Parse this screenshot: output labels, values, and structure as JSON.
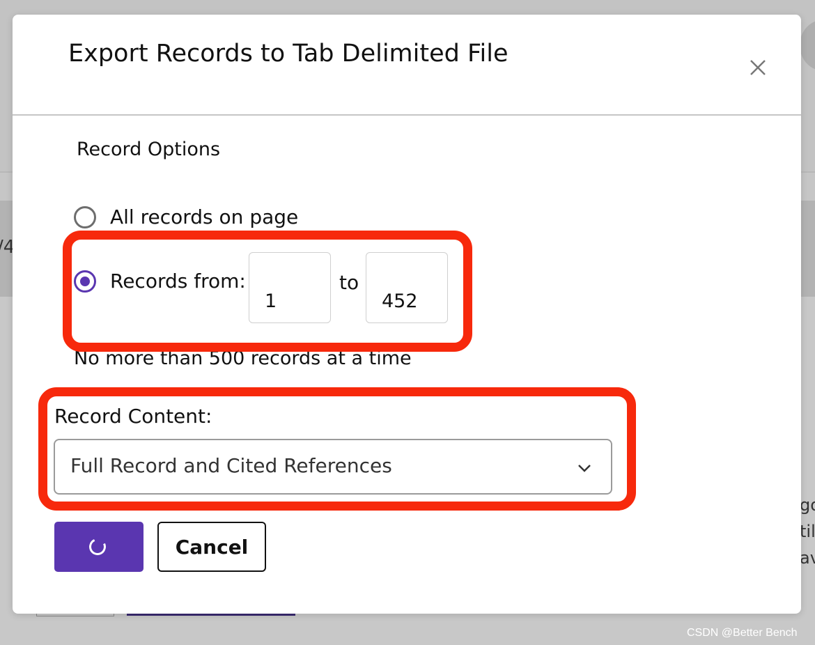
{
  "dialog": {
    "title": "Export Records to Tab Delimited File",
    "close_icon": "close-icon"
  },
  "record_options": {
    "label": "Record Options",
    "options": [
      {
        "label": "All records on page",
        "selected": false
      },
      {
        "label": "Records from:",
        "selected": true
      }
    ],
    "from_value": "1",
    "to_label": "to",
    "to_value": "452",
    "limit_note": "No more than 500 records at a time"
  },
  "record_content": {
    "label": "Record Content:",
    "selected": "Full Record and Cited References",
    "chevron_icon": "chevron-down-icon"
  },
  "buttons": {
    "export_icon": "loading-spinner-icon",
    "cancel_label": "Cancel"
  },
  "background": {
    "left_fragment": "/4",
    "right_fragments": [
      "gor",
      "till",
      "ava"
    ]
  },
  "watermark": "CSDN @Better Bench",
  "colors": {
    "accent": "#5a36b0",
    "highlight": "#f7290c"
  }
}
